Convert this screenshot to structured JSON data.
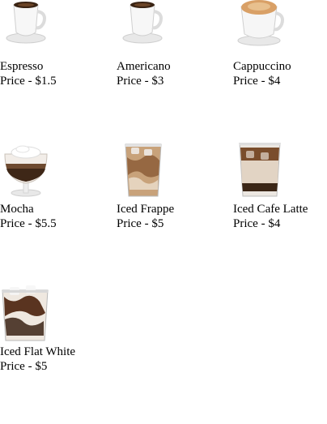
{
  "menu": {
    "items": [
      {
        "name": "Espresso",
        "price": "Price - $1.5",
        "icon": "espresso-cup-icon"
      },
      {
        "name": "Americano",
        "price": "Price - $3",
        "icon": "americano-cup-icon"
      },
      {
        "name": "Cappuccino",
        "price": "Price - $4",
        "icon": "cappuccino-cup-icon"
      },
      {
        "name": "Mocha",
        "price": "Price - $5.5",
        "icon": "mocha-glass-icon"
      },
      {
        "name": "Iced Frappe",
        "price": "Price - $5",
        "icon": "iced-frappe-glass-icon"
      },
      {
        "name": "Iced Cafe Latte",
        "price": "Price - $4",
        "icon": "iced-cafe-latte-glass-icon"
      },
      {
        "name": "Iced Flat White",
        "price": "Price - $5",
        "icon": "iced-flat-white-glass-icon"
      }
    ]
  }
}
